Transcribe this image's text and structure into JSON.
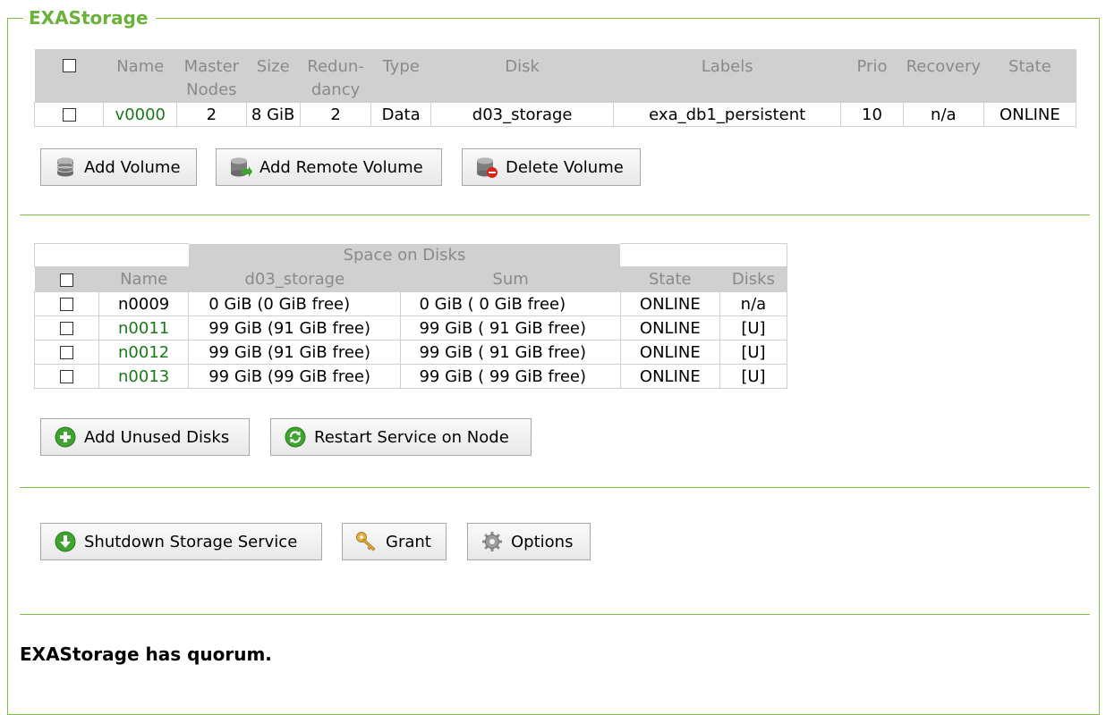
{
  "title": "EXAStorage",
  "volumes": {
    "headers": [
      {
        "line1": "Name",
        "line2": ""
      },
      {
        "line1": "Master",
        "line2": "Nodes"
      },
      {
        "line1": "Size",
        "line2": ""
      },
      {
        "line1": "Redun-",
        "line2": "dancy"
      },
      {
        "line1": "Type",
        "line2": ""
      },
      {
        "line1": "Disk",
        "line2": ""
      },
      {
        "line1": "Labels",
        "line2": ""
      },
      {
        "line1": "Prio",
        "line2": ""
      },
      {
        "line1": "Recovery",
        "line2": ""
      },
      {
        "line1": "State",
        "line2": ""
      }
    ],
    "rows": [
      {
        "name": "v0000",
        "master_nodes": "2",
        "size": "8 GiB",
        "redundancy": "2",
        "type": "Data",
        "disk": "d03_storage",
        "labels": "exa_db1_persistent",
        "prio": "10",
        "recovery": "n/a",
        "state": "ONLINE"
      }
    ],
    "buttons": {
      "add_volume": "Add Volume",
      "add_remote_volume": "Add Remote Volume",
      "delete_volume": "Delete Volume"
    }
  },
  "nodes": {
    "group_header": "Space on Disks",
    "headers": {
      "name": "Name",
      "disk": "d03_storage",
      "sum": "Sum",
      "state": "State",
      "disks": "Disks"
    },
    "rows": [
      {
        "name": "n0009",
        "disk": "0 GiB (0 GiB free)",
        "sum": "0 GiB ( 0 GiB free)",
        "state": "ONLINE",
        "disks": "n/a",
        "link": false
      },
      {
        "name": "n0011",
        "disk": "99 GiB (91 GiB free)",
        "sum": "99 GiB ( 91 GiB free)",
        "state": "ONLINE",
        "disks": "[U]",
        "link": true
      },
      {
        "name": "n0012",
        "disk": "99 GiB (91 GiB free)",
        "sum": "99 GiB ( 91 GiB free)",
        "state": "ONLINE",
        "disks": "[U]",
        "link": true
      },
      {
        "name": "n0013",
        "disk": "99 GiB (99 GiB free)",
        "sum": "99 GiB ( 99 GiB free)",
        "state": "ONLINE",
        "disks": "[U]",
        "link": true
      }
    ],
    "buttons": {
      "add_unused_disks": "Add Unused Disks",
      "restart_service": "Restart Service on Node"
    }
  },
  "service": {
    "buttons": {
      "shutdown": "Shutdown Storage Service",
      "grant": "Grant",
      "options": "Options"
    }
  },
  "status": "EXAStorage has quorum.",
  "colors": {
    "accent": "#6ab23a",
    "border": "#7fc241",
    "link": "#1a7a1a",
    "header_bg": "#d0d0d0"
  }
}
